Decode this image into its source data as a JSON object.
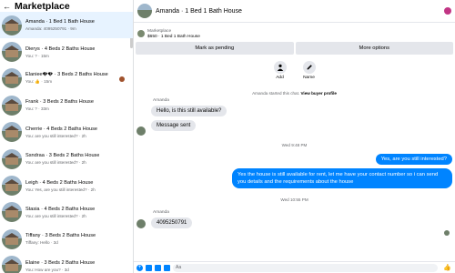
{
  "sidebar": {
    "back_glyph": "←",
    "title": "Marketplace",
    "conversations": [
      {
        "title": "Amanda · 1 Bed 1 Bath House",
        "subtitle": "Amanda: 4095250791 · 9m",
        "selected": true
      },
      {
        "title": "Dierys · 4 Beds 2 Baths House",
        "subtitle": "You: ? · 15m"
      },
      {
        "title": "Elaniee�� · 3 Beds 2 Baths House",
        "subtitle": "You: 👍 · 15m",
        "seen_avatar": true
      },
      {
        "title": "Frank · 3 Beds 2 Baths House",
        "subtitle": "You: ? · 33m"
      },
      {
        "title": "Cherrie · 4 Beds 2 Baths House",
        "subtitle": "You: are you still interested? · 2h"
      },
      {
        "title": "Ssndraa · 3 Beds 2 Baths House",
        "subtitle": "You: are you still interested? · 2h"
      },
      {
        "title": "Leigh · 4 Beds 2 Baths House",
        "subtitle": "You: Yes, are you still interested? · 2h"
      },
      {
        "title": "Stasia · 4 Beds 2 Baths House",
        "subtitle": "You: are you still interested? · 2h"
      },
      {
        "title": "Tiffany · 3 Beds 2 Baths House",
        "subtitle": "Tiffany: Hello · 3d"
      },
      {
        "title": "Elaine · 3 Beds 2 Baths House",
        "subtitle": "You: How are you? · 3d"
      }
    ]
  },
  "chat": {
    "title": "Amanda · 1 Bed 1 Bath House",
    "listing_source": "Marketplace",
    "listing_price": "$650 · 1 Bed 1 Bath House",
    "mark_pending": "Mark as pending",
    "more_options": "More options",
    "quick_add": "Add",
    "quick_name": "Name",
    "system_text": "Amanda started this chat.",
    "system_link": "View buyer profile",
    "sender1": "Amanda",
    "msg1": "Hello, is this still available?",
    "msg2": "Message sent",
    "time1": "Wed 9:48 PM",
    "out1": "Yes, are you still interested?",
    "out2": "Yes the house is still available for rent, let me have your contact number so i can send you details and the requirements about the house",
    "time2": "Wed 10:55 PM",
    "sender2": "Amanda",
    "msg3": "4095250791",
    "composer_placeholder": "Aa",
    "like_glyph": "👍"
  },
  "colors": {
    "accent": "#0084ff",
    "selected_bg": "#e7f3ff",
    "bubble_in": "#e4e6eb"
  }
}
